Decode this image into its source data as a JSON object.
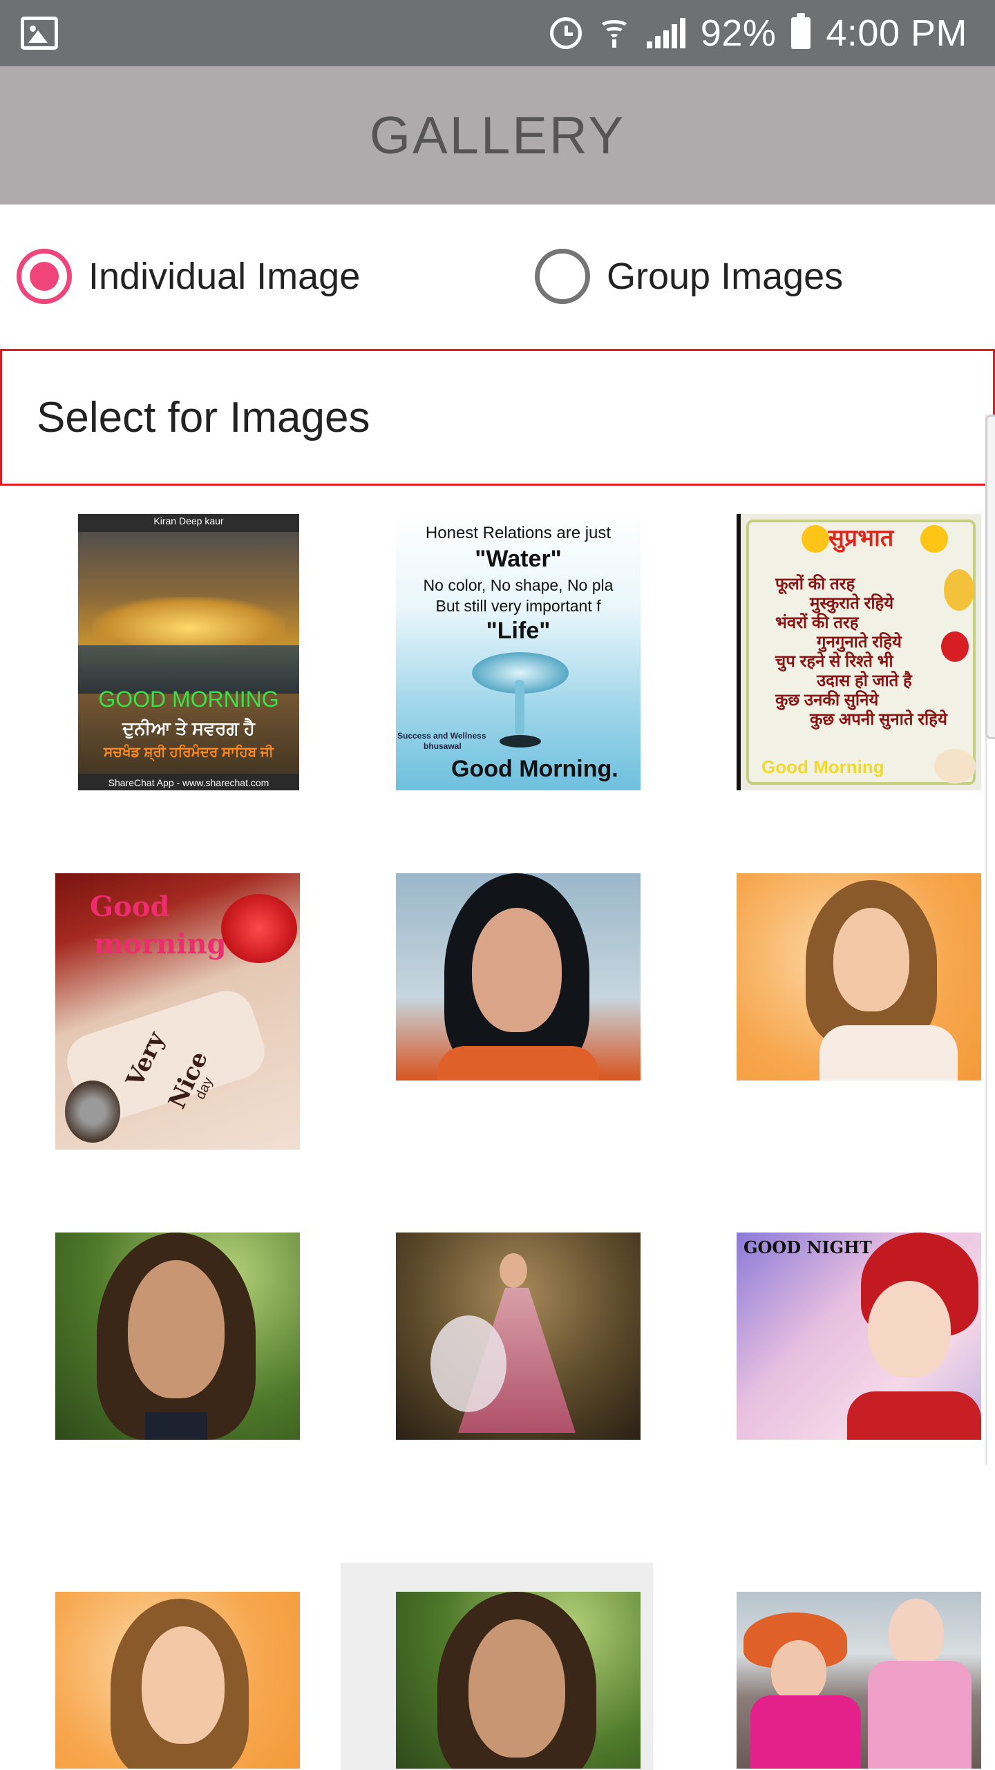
{
  "status_bar": {
    "battery_text": "92%",
    "time": "4:00 PM",
    "icons": [
      "gallery-icon",
      "alarm-icon",
      "wifi-icon",
      "signal-icon",
      "battery-icon"
    ]
  },
  "header": {
    "title": "GALLERY"
  },
  "view_mode": {
    "options": [
      {
        "label": "Individual Image",
        "selected": true
      },
      {
        "label": "Group Images",
        "selected": false
      }
    ],
    "accent_color": "#f0457a"
  },
  "select_field": {
    "label": "Select for Images",
    "border_color": "#e31c23"
  },
  "thumbnails": [
    {
      "name": "golden-temple-good-morning",
      "texts": [
        "Kiran Deep kaur",
        "GOOD MORNING",
        "ਦੁਨੀਆ ਤੇ ਸਵਰਗ ਹੈ",
        "ਸਚਖੰਡ ਸ਼੍ਰੀ ਹਰਿਮੰਦਰ ਸਾਹਿਬ ਜੀ",
        "ShareChat App - www.sharechat.com"
      ]
    },
    {
      "name": "water-quote-good-morning",
      "texts": [
        "Honest Relations are just",
        "\"Water\"",
        "No color, No shape, No pla",
        "But still very important f",
        "\"Life\"",
        "Success and Wellness",
        "bhusawal",
        "Good Morning."
      ]
    },
    {
      "name": "suprabhat-hindi-card",
      "texts": [
        "सुप्रभात",
        "फूलों की तरह",
        "मुस्कुराते रहिये",
        "भंवरों की तरह",
        "गुनगुनाते रहिये",
        "चुप रहने से रिश्ते भी",
        "उदास हो जाते है",
        "कुछ उनकी सुनिये",
        "कुछ अपनी सुनाते रहिये",
        "Good Morning"
      ]
    },
    {
      "name": "good-morning-rose-hand",
      "texts": [
        "Good",
        "morning",
        "Very",
        "Nice",
        "day"
      ]
    },
    {
      "name": "woman-portrait-dark-hair",
      "texts": []
    },
    {
      "name": "woman-portrait-curly-hair",
      "texts": []
    },
    {
      "name": "woman-portrait-green-background",
      "texts": []
    },
    {
      "name": "woman-in-pink-dress-forest",
      "texts": []
    },
    {
      "name": "good-night-girl-red-hat",
      "texts": [
        "GOOD NIGHT"
      ]
    },
    {
      "name": "woman-portrait-curly-hair-2",
      "texts": []
    },
    {
      "name": "woman-portrait-green-background-2",
      "texts": []
    },
    {
      "name": "girls-playing-outdoors",
      "texts": []
    }
  ]
}
